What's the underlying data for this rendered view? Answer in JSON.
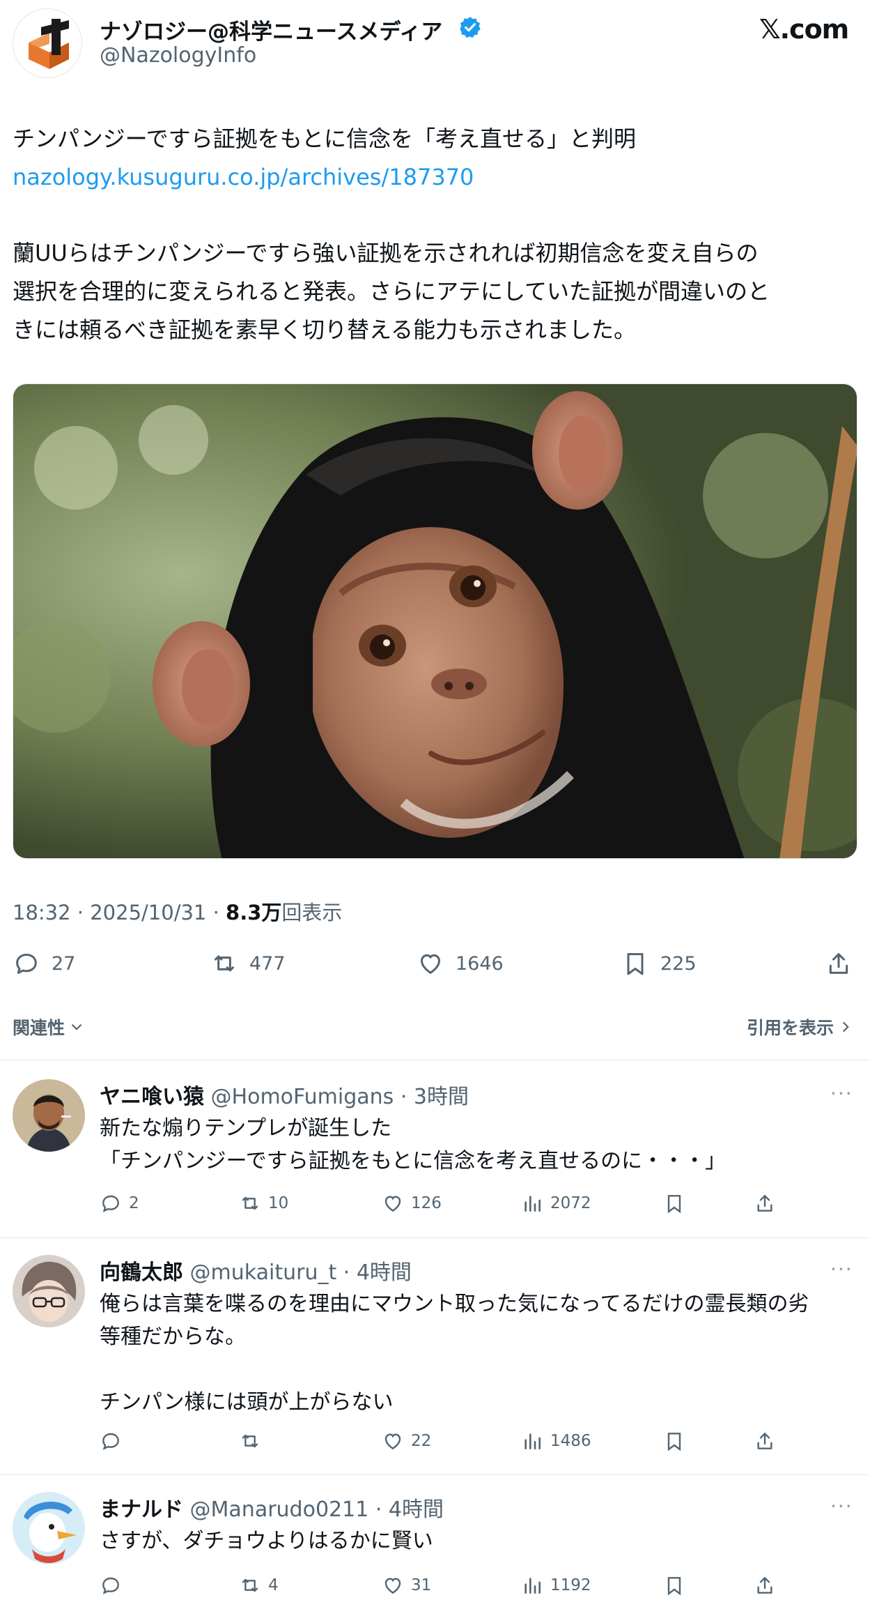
{
  "tweet": {
    "display_name": "ナゾロジー@科学ニュースメディア",
    "handle": "@NazologyInfo",
    "brand": "𝕏.com",
    "headline": "チンパンジーですら証拠をもとに信念を「考え直せる」と判明",
    "link": "nazology.kusuguru.co.jp/archives/187370",
    "body_lines": [
      "蘭UUらはチンパンジーですら強い証拠を示されれば初期信念を変え自らの",
      "選択を合理的に変えられると発表。さらにアテにしていた証拠が間違いのと",
      "きには頼るべき証拠を素早く切り替える能力も示されました。"
    ],
    "time": "18:32 · 2025/10/31 · ",
    "views": "8.3万",
    "views_suffix": "回表示",
    "replies": "27",
    "retweets": "477",
    "likes": "1646",
    "bookmarks": "225",
    "sort_label": "関連性",
    "quotes_label": "引用を表示"
  },
  "replies": [
    {
      "name": "ヤニ喰い猿",
      "meta": " @HomoFumigans · 3時間",
      "lines": [
        "新たな煽りテンプレが誕生した",
        "「チンパンジーですら証拠をもとに信念を考え直せるのに・・・」"
      ],
      "replies": "2",
      "retweets": "10",
      "likes": "126",
      "views": "2072"
    },
    {
      "name": "向鶴太郎",
      "meta": " @mukaituru_t · 4時間",
      "lines": [
        "俺らは言葉を喋るのを理由にマウント取った気になってるだけの霊長類の劣",
        "等種だからな。",
        "",
        "チンパン様には頭が上がらない"
      ],
      "replies": "",
      "retweets": "",
      "likes": "22",
      "views": "1486"
    },
    {
      "name": "まナルド",
      "meta": " @Manarudo0211 · 4時間",
      "lines": [
        "さすが、ダチョウよりはるかに賢い"
      ],
      "replies": "",
      "retweets": "4",
      "likes": "31",
      "views": "1192"
    }
  ],
  "more_label": "···",
  "colors": {
    "link": "#1d9bf0",
    "verified": "#1d9bf0",
    "muted": "#536471",
    "logo_orange": "#e8772e"
  },
  "icons": [
    "comment-icon",
    "retweet-icon",
    "heart-icon",
    "bookmark-icon",
    "share-icon",
    "views-icon",
    "verified-icon",
    "chevron-down-icon",
    "chevron-right-icon"
  ]
}
